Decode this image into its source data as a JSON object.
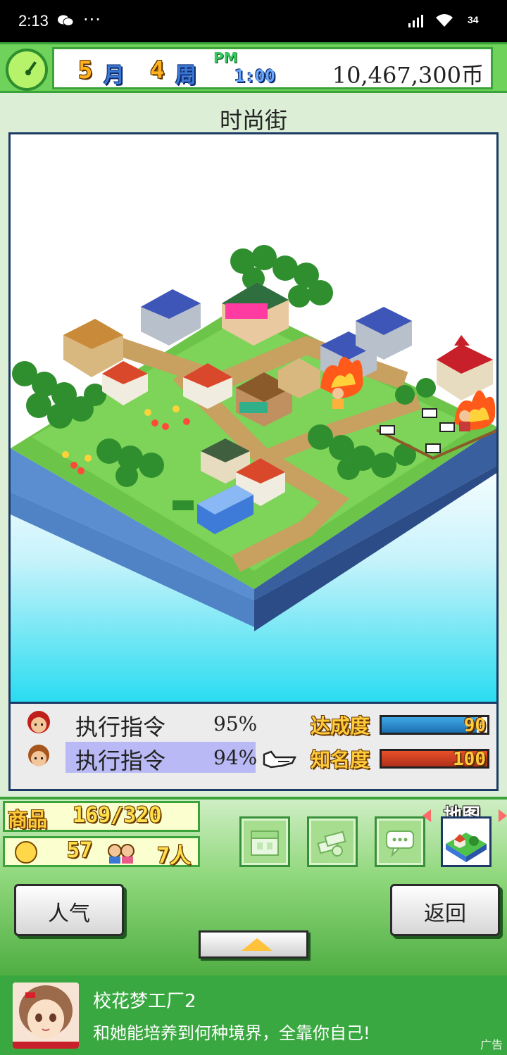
{
  "status_bar": {
    "time": "2:13",
    "dots": "···",
    "battery": "34"
  },
  "header": {
    "month_num": "5",
    "month_label": "月",
    "week_num": "4",
    "week_label": "周",
    "ampm": "PM",
    "time": "1:00",
    "money": "10,467,300币"
  },
  "area_title": "时尚街",
  "staff": [
    {
      "command": "执行指令",
      "percent": "95%",
      "hair_color": "#c0201c"
    },
    {
      "command": "执行指令",
      "percent": "94%",
      "hair_color": "#a6551c"
    }
  ],
  "stats": {
    "achievement_label": "达成度",
    "achievement_value": "90",
    "achievement_fill": 0.9,
    "achievement_color": "#3fa8e8",
    "fame_label": "知名度",
    "fame_value": "100",
    "fame_fill": 1.0,
    "fame_color": "#e8502a"
  },
  "stock": {
    "goods_label": "商品",
    "goods_value": "169/320",
    "satisfaction": "57",
    "people": "7人"
  },
  "tools": [
    {
      "icon": "store-icon"
    },
    {
      "icon": "money-icon"
    },
    {
      "icon": "chat-icon"
    }
  ],
  "map_button": {
    "label": "地图"
  },
  "buttons": {
    "popularity": "人气",
    "back": "返回"
  },
  "ad": {
    "name": "校花梦工厂2",
    "desc": "和她能培养到何种境界，全靠你自己!",
    "tag": "广告"
  },
  "colors": {
    "accent_green": "#6fd25a",
    "frame_blue": "#1d3a66",
    "select_purple": "#b9b9f5"
  }
}
